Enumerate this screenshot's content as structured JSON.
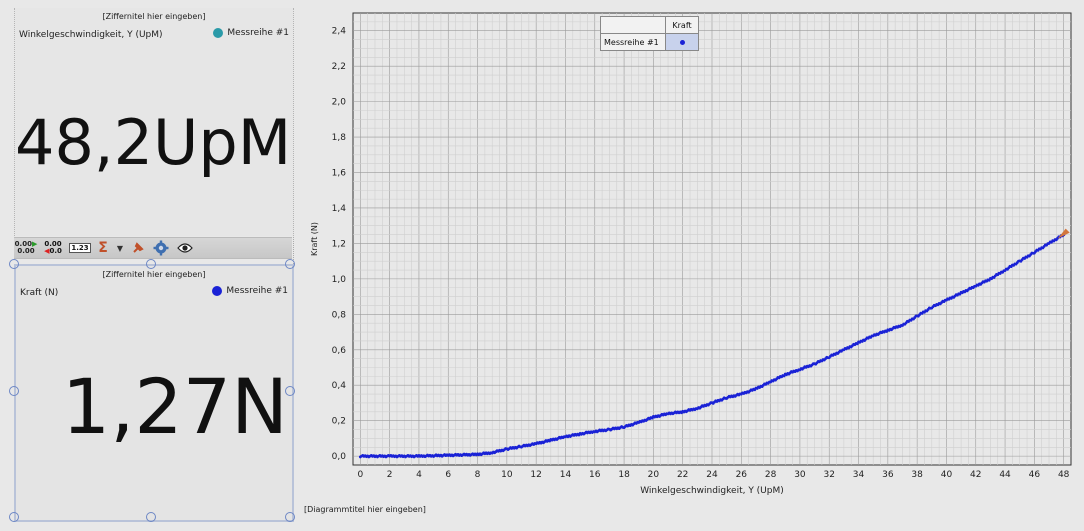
{
  "digit_panel_top": {
    "title": "[Ziffernitel hier eingeben]",
    "label": "Winkelgeschwindigkeit, Y (UpM)",
    "legend": "Messreihe #1",
    "legend_color": "#2a9aa8",
    "value": "48,2UpM"
  },
  "toolbar": {
    "icons": [
      "number-format-icon",
      "decimal-places-icon",
      "value-display-icon",
      "sigma-icon",
      "dropdown-icon",
      "pin-icon",
      "gear-icon",
      "eye-icon"
    ],
    "number_format_text": "0.00",
    "value_display_text": "1.23"
  },
  "digit_panel_bottom": {
    "title": "[Ziffernitel hier eingeben]",
    "label": "Kraft (N)",
    "legend": "Messreihe #1",
    "legend_color": "#1a22d6",
    "value": "1,27N"
  },
  "chart_caption": "[Diagrammtitel hier eingeben]",
  "legend_table": {
    "header_blank": "",
    "header": "Kraft",
    "row_label": "Messreihe #1"
  },
  "chart_data": {
    "type": "scatter",
    "xlabel": "Winkelgeschwindigkeit, Y (UpM)",
    "ylabel": "Kraft (N)",
    "xlim": [
      -0.5,
      48.5
    ],
    "ylim": [
      -0.05,
      2.5
    ],
    "xticks": [
      0,
      2,
      4,
      6,
      8,
      10,
      12,
      14,
      16,
      18,
      20,
      22,
      24,
      26,
      28,
      30,
      32,
      34,
      36,
      38,
      40,
      42,
      44,
      46,
      48
    ],
    "yticks": [
      "0,0",
      "0,2",
      "0,4",
      "0,6",
      "0,8",
      "1,0",
      "1,2",
      "1,4",
      "1,6",
      "1,8",
      "2,0",
      "2,2",
      "2,4"
    ],
    "ytick_values": [
      0,
      0.2,
      0.4,
      0.6,
      0.8,
      1.0,
      1.2,
      1.4,
      1.6,
      1.8,
      2.0,
      2.2,
      2.4
    ],
    "grid": true,
    "color": "#1a22d6",
    "series": [
      {
        "name": "Messreihe #1",
        "x": [
          0,
          2,
          4,
          6,
          8,
          9,
          10,
          11,
          12,
          13,
          14,
          15,
          16,
          17,
          18,
          19,
          20,
          21,
          22,
          23,
          24,
          25,
          26,
          27,
          28,
          29,
          30,
          31,
          32,
          33,
          34,
          35,
          36,
          37,
          38,
          39,
          40,
          41,
          42,
          43,
          44,
          45,
          46,
          47,
          48
        ],
        "y": [
          0.0,
          0.0,
          0.0,
          0.005,
          0.01,
          0.02,
          0.04,
          0.055,
          0.07,
          0.09,
          0.11,
          0.125,
          0.14,
          0.15,
          0.165,
          0.19,
          0.22,
          0.24,
          0.25,
          0.27,
          0.3,
          0.33,
          0.35,
          0.38,
          0.42,
          0.46,
          0.49,
          0.52,
          0.56,
          0.6,
          0.64,
          0.68,
          0.71,
          0.74,
          0.79,
          0.84,
          0.88,
          0.92,
          0.96,
          1.0,
          1.05,
          1.1,
          1.15,
          1.2,
          1.25
        ]
      }
    ]
  }
}
